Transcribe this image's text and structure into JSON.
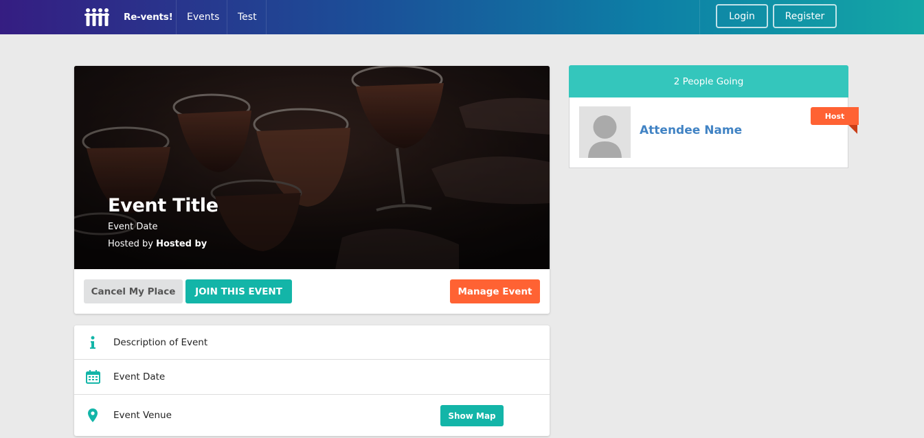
{
  "nav": {
    "brand": "Re-vents!",
    "items": [
      "Events",
      "Test"
    ],
    "login": "Login",
    "register": "Register"
  },
  "event": {
    "title": "Event Title",
    "date": "Event Date",
    "hosted_prefix": "Hosted by ",
    "hosted_by": "Hosted by",
    "cancel": "Cancel My Place",
    "join": "JOIN THIS EVENT",
    "manage": "Manage Event"
  },
  "info": {
    "description": "Description of Event",
    "date": "Event Date",
    "venue": "Event Venue",
    "show_map": "Show Map"
  },
  "attendees": {
    "heading": "2 People Going",
    "list": [
      {
        "name": "Attendee Name",
        "badge": "Host"
      }
    ]
  },
  "colors": {
    "teal": "#13b5a8",
    "orange": "#ff6233",
    "header_teal": "#34c6bc",
    "link_blue": "#4183c4"
  }
}
